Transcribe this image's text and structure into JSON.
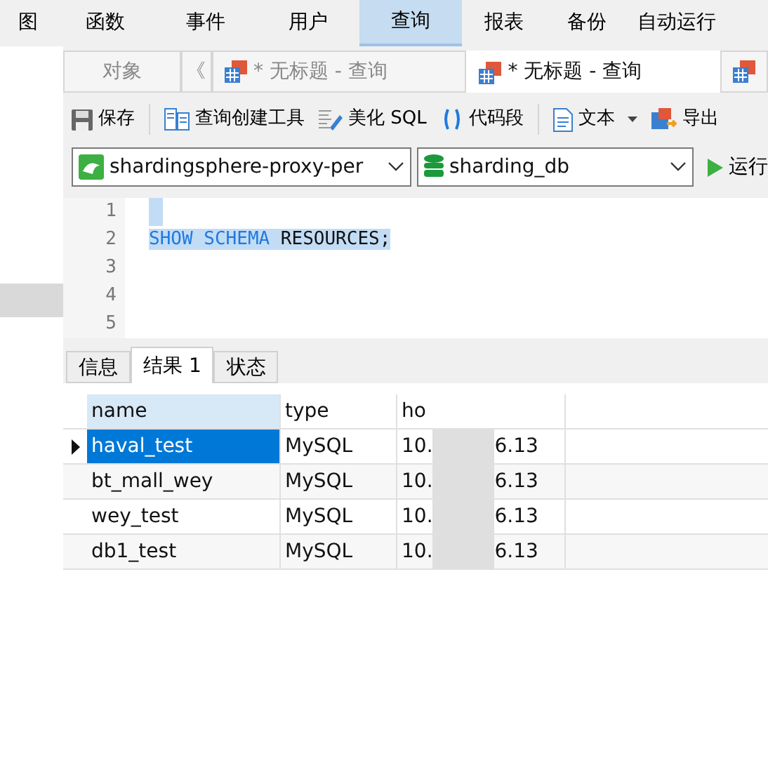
{
  "menu": [
    {
      "label": "图",
      "selected": false
    },
    {
      "label": "函数",
      "selected": false
    },
    {
      "label": "事件",
      "selected": false
    },
    {
      "label": "用户",
      "selected": false
    },
    {
      "label": "查询",
      "selected": true
    },
    {
      "label": "报表",
      "selected": false
    },
    {
      "label": "备份",
      "selected": false
    },
    {
      "label": "自动运行",
      "selected": false
    }
  ],
  "doc_tabs": {
    "objects_label": "对象",
    "scroll_glyph": "《",
    "tabs": [
      {
        "label": "* 无标题 - 查询",
        "selected": false
      },
      {
        "label": "* 无标题 - 查询",
        "selected": true
      }
    ]
  },
  "toolbar": [
    {
      "kind": "save",
      "label": "保存"
    },
    {
      "kind": "builder",
      "label": "查询创建工具"
    },
    {
      "kind": "beautify",
      "label": "美化 SQL"
    },
    {
      "kind": "snippet",
      "label": "代码段"
    },
    {
      "kind": "text",
      "label": "文本"
    },
    {
      "kind": "export",
      "label": "导出"
    }
  ],
  "connection": {
    "value": "shardingsphere-proxy-per"
  },
  "database": {
    "value": "sharding_db"
  },
  "run_label": "运行",
  "editor": {
    "lines": [
      {
        "number": "1"
      },
      {
        "number": "2",
        "tokens": [
          {
            "kind": "keyword",
            "text": "SHOW SCHEMA"
          },
          {
            "kind": "plain",
            "text": " RESOURCES;"
          }
        ]
      },
      {
        "number": "3"
      },
      {
        "number": "4"
      },
      {
        "number": "5"
      }
    ]
  },
  "result_tabs": [
    {
      "label": "信息",
      "selected": false
    },
    {
      "label": "结果 1",
      "selected": true
    },
    {
      "label": "状态",
      "selected": false
    }
  ],
  "table": {
    "columns": [
      "name",
      "type",
      "ho"
    ],
    "rows": [
      {
        "selected": true,
        "name": "haval_test",
        "type": "MySQL",
        "host_start": "10.",
        "host_end": "6.13"
      },
      {
        "selected": false,
        "name": "bt_mall_wey",
        "type": "MySQL",
        "host_start": "10.",
        "host_end": "6.13"
      },
      {
        "selected": false,
        "name": "wey_test",
        "type": "MySQL",
        "host_start": "10.",
        "host_end": "6.13"
      },
      {
        "selected": false,
        "name": "db1_test",
        "type": "MySQL",
        "host_start": "10.",
        "host_end": "6.13"
      }
    ]
  }
}
